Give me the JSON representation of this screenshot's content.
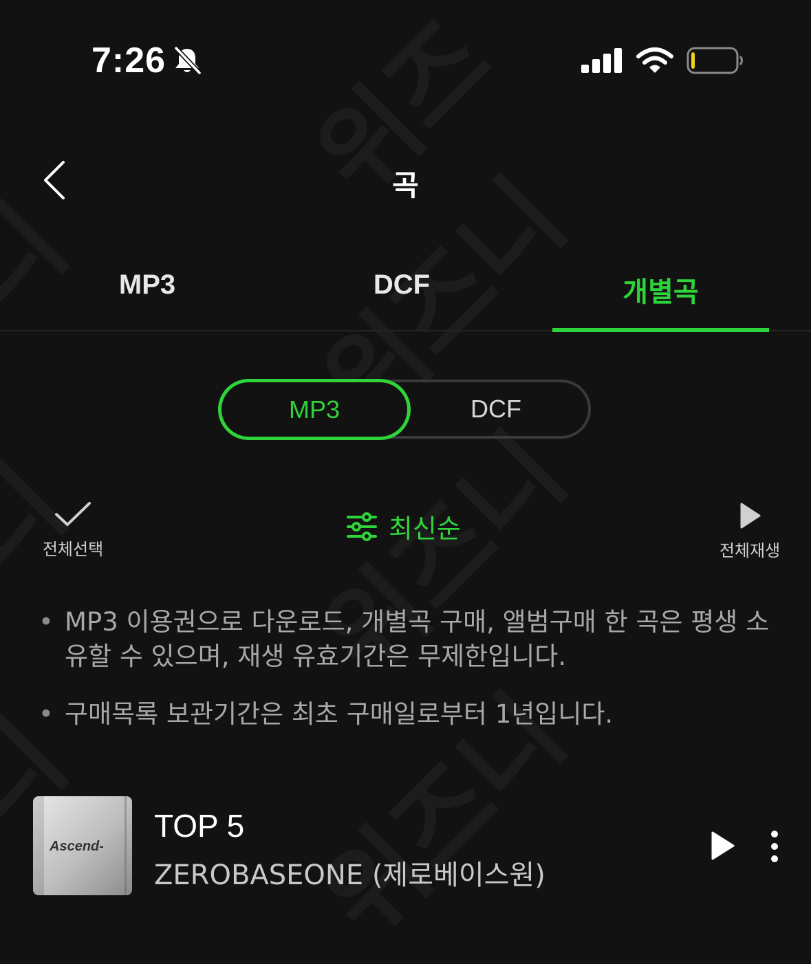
{
  "status_bar": {
    "time": "7:26",
    "icons": [
      "bell-slash-icon",
      "cellular-signal-icon",
      "wifi-icon",
      "battery-icon"
    ],
    "battery_level": 0.08
  },
  "header": {
    "title": "곡",
    "back_icon": "chevron-left-icon"
  },
  "tabs": [
    {
      "label": "MP3",
      "active": false
    },
    {
      "label": "DCF",
      "active": false
    },
    {
      "label": "개별곡",
      "active": true
    }
  ],
  "format_toggle": {
    "options": [
      "MP3",
      "DCF"
    ],
    "selected": "MP3"
  },
  "toolbar": {
    "select_all_label": "전체선택",
    "sort_label": "최신순",
    "play_all_label": "전체재생"
  },
  "notes": [
    "MP3 이용권으로 다운로드, 개별곡 구매, 앨범구매 한 곡은 평생 소유할 수 있으며, 재생 유효기간은 무제한입니다.",
    "구매목록 보관기간은 최초 구매일로부터 1년입니다."
  ],
  "songs": [
    {
      "title": "TOP 5",
      "artist": "ZEROBASEONE (제로베이스원)",
      "album_art_text": "Ascend-"
    }
  ],
  "colors": {
    "accent": "#2fd33a",
    "background": "#121212"
  }
}
